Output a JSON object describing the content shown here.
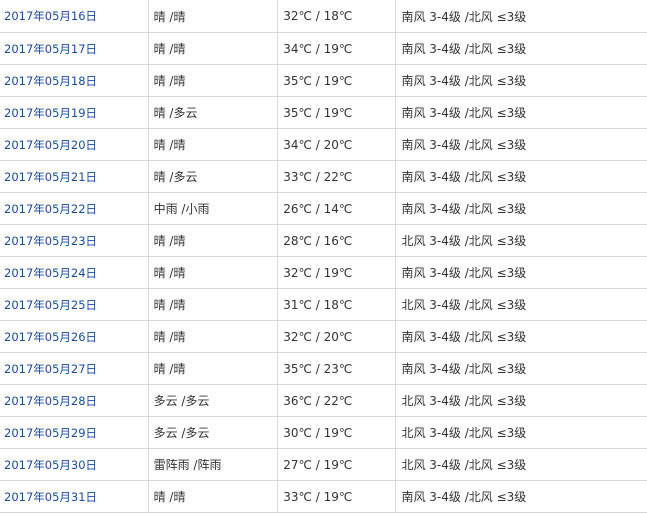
{
  "rows": [
    {
      "date": "2017年05月16日",
      "condition": "晴 /晴",
      "temp": "32℃ / 18℃",
      "wind": "南风 3-4级 /北风 ≤3级"
    },
    {
      "date": "2017年05月17日",
      "condition": "晴 /晴",
      "temp": "34℃ / 19℃",
      "wind": "南风 3-4级 /北风 ≤3级"
    },
    {
      "date": "2017年05月18日",
      "condition": "晴 /晴",
      "temp": "35℃ / 19℃",
      "wind": "南风 3-4级 /北风 ≤3级"
    },
    {
      "date": "2017年05月19日",
      "condition": "晴 /多云",
      "temp": "35℃ / 19℃",
      "wind": "南风 3-4级 /北风 ≤3级"
    },
    {
      "date": "2017年05月20日",
      "condition": "晴 /晴",
      "temp": "34℃ / 20℃",
      "wind": "南风 3-4级 /北风 ≤3级"
    },
    {
      "date": "2017年05月21日",
      "condition": "晴 /多云",
      "temp": "33℃ / 22℃",
      "wind": "南风 3-4级 /北风 ≤3级"
    },
    {
      "date": "2017年05月22日",
      "condition": "中雨 /小雨",
      "temp": "26℃ / 14℃",
      "wind": "南风 3-4级 /北风 ≤3级"
    },
    {
      "date": "2017年05月23日",
      "condition": "晴 /晴",
      "temp": "28℃ / 16℃",
      "wind": "北风 3-4级 /北风 ≤3级"
    },
    {
      "date": "2017年05月24日",
      "condition": "晴 /晴",
      "temp": "32℃ / 19℃",
      "wind": "南风 3-4级 /北风 ≤3级"
    },
    {
      "date": "2017年05月25日",
      "condition": "晴 /晴",
      "temp": "31℃ / 18℃",
      "wind": "北风 3-4级 /北风 ≤3级"
    },
    {
      "date": "2017年05月26日",
      "condition": "晴 /晴",
      "temp": "32℃ / 20℃",
      "wind": "南风 3-4级 /北风 ≤3级"
    },
    {
      "date": "2017年05月27日",
      "condition": "晴 /晴",
      "temp": "35℃ / 23℃",
      "wind": "南风 3-4级 /北风 ≤3级"
    },
    {
      "date": "2017年05月28日",
      "condition": "多云 /多云",
      "temp": "36℃ / 22℃",
      "wind": "北风 3-4级 /北风 ≤3级"
    },
    {
      "date": "2017年05月29日",
      "condition": "多云 /多云",
      "temp": "30℃ / 19℃",
      "wind": "北风 3-4级 /北风 ≤3级"
    },
    {
      "date": "2017年05月30日",
      "condition": "雷阵雨 /阵雨",
      "temp": "27℃ / 19℃",
      "wind": "北风 3-4级 /北风 ≤3级"
    },
    {
      "date": "2017年05月31日",
      "condition": "晴 /晴",
      "temp": "33℃ / 19℃",
      "wind": "南风 3-4级 /北风 ≤3级"
    }
  ],
  "colors": {
    "link": "#1a4a9c",
    "text": "#333333",
    "border": "#d8d8d8"
  }
}
